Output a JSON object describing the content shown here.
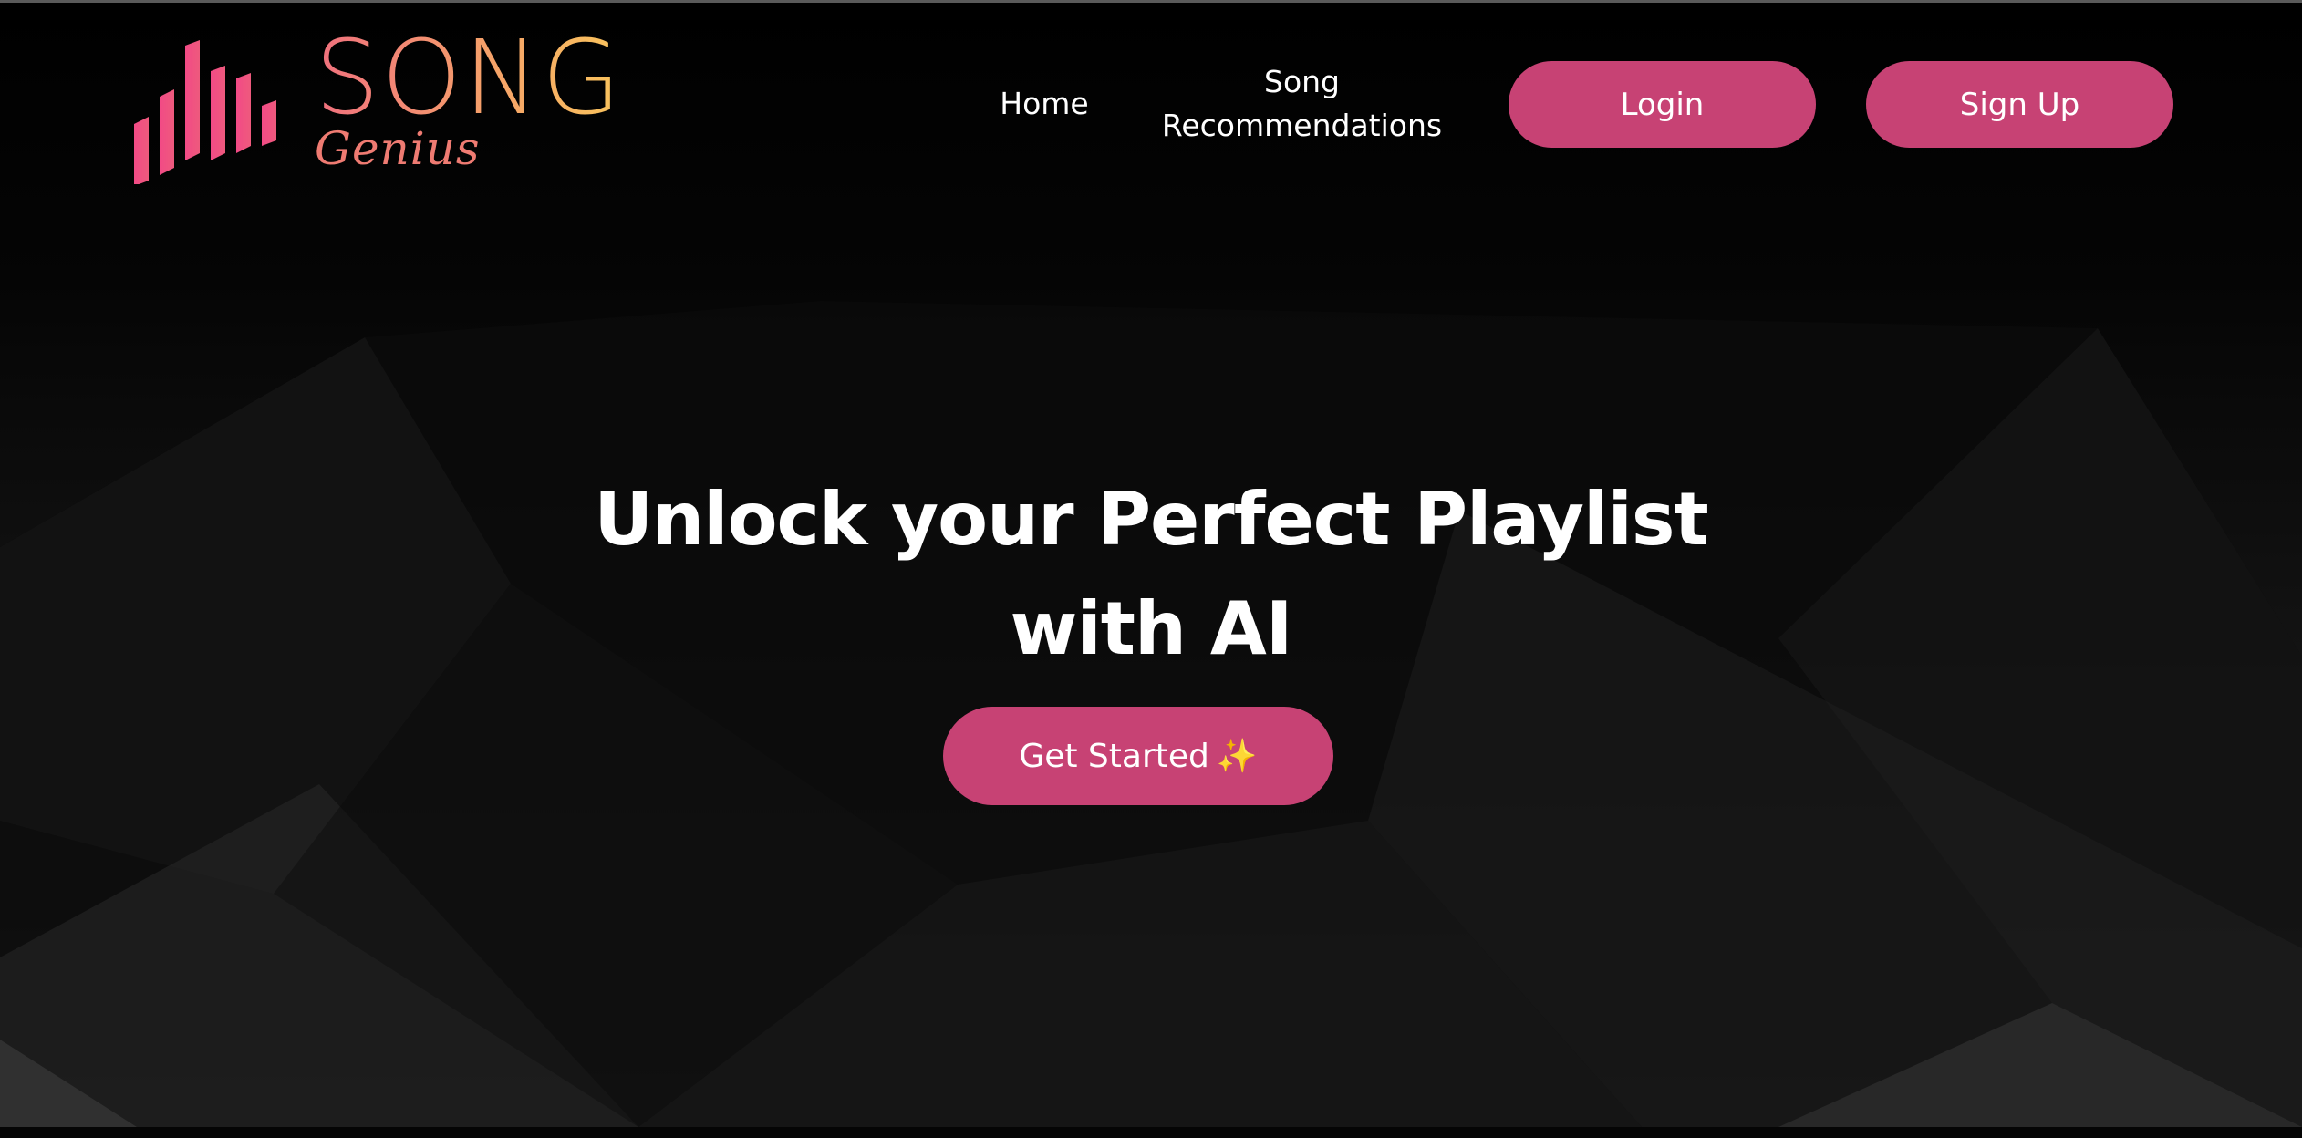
{
  "brand": {
    "name": "SONG",
    "tagline": "Genius",
    "gradient_start": "#f0707e",
    "gradient_end": "#f9c45c"
  },
  "nav": {
    "home": "Home",
    "recommendations": "Song Recommendations",
    "login": "Login",
    "signup": "Sign Up"
  },
  "hero": {
    "title_line1": "Unlock your Perfect Playlist",
    "title_line2": "with AI",
    "cta_label": "Get Started",
    "cta_icon": "sparkles-icon",
    "cta_emoji": "✨"
  },
  "colors": {
    "accent": "#c74274",
    "background": "#000000",
    "text": "#ffffff"
  }
}
